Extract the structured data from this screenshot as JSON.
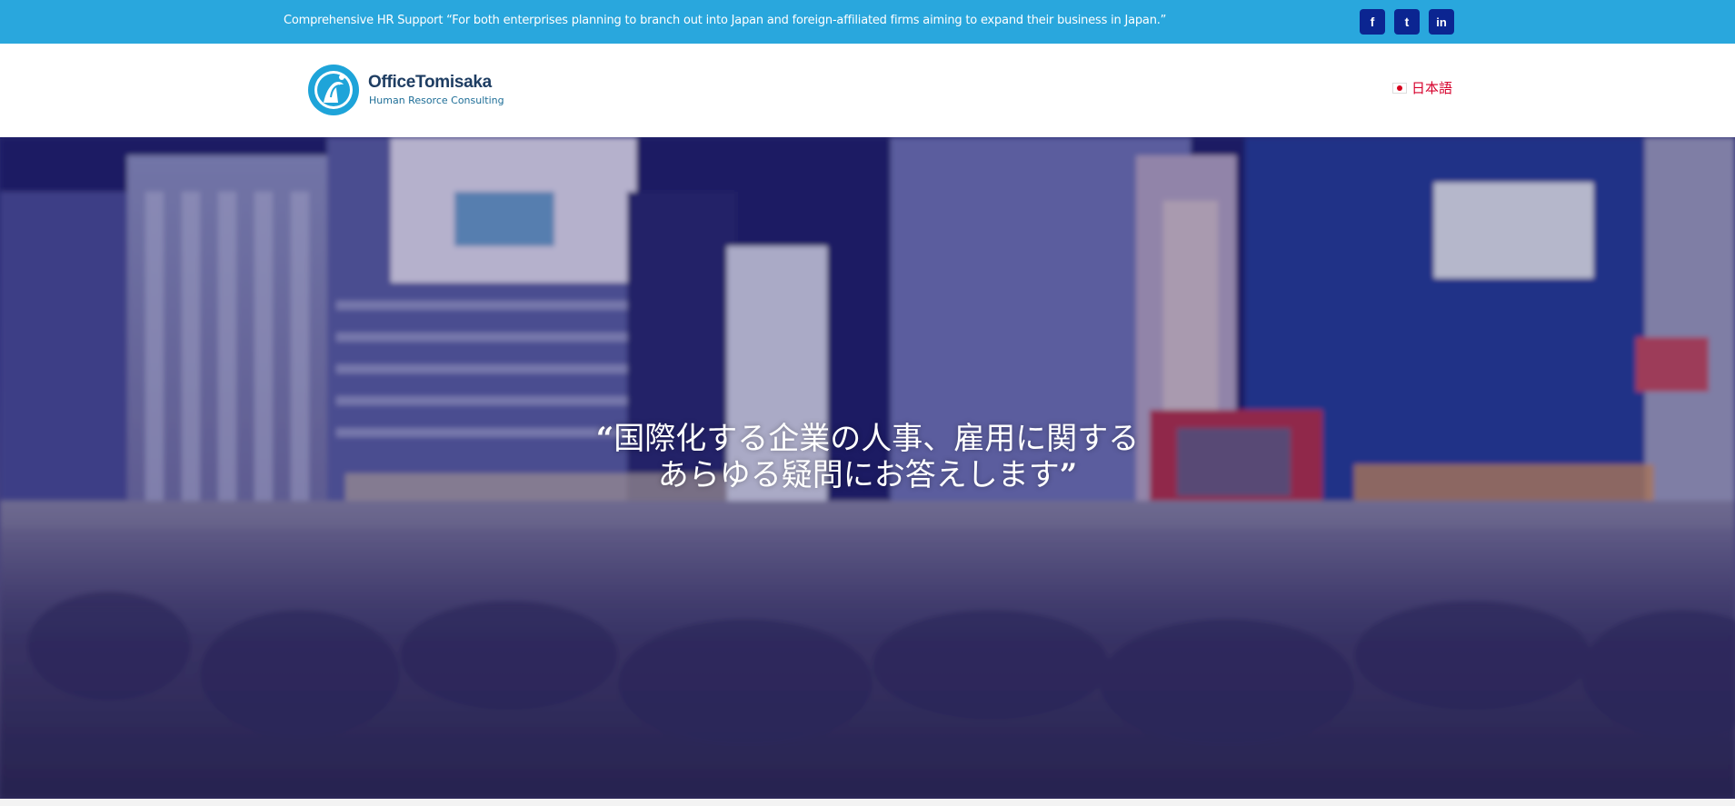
{
  "topbar": {
    "text": "Comprehensive HR Support “For both enterprises planning to branch out into Japan and foreign-affiliated firms aiming to expand their business in Japan.”",
    "background": "#29a7dd",
    "social": [
      {
        "icon": "facebook-icon",
        "glyph": "f"
      },
      {
        "icon": "tumblr-icon",
        "glyph": "t"
      },
      {
        "icon": "linkedin-icon",
        "glyph": "in"
      }
    ]
  },
  "header": {
    "logo": {
      "title": "OfficeTomisaka",
      "subtitle": "Human Resorce Consulting"
    },
    "language": {
      "flag_icon": "japan-flag-icon",
      "label": "日本語",
      "color": "#d6002c"
    }
  },
  "hero": {
    "quote_open": "“",
    "line1": "国際化する企業の人事、雇用に関する",
    "line2": "あらゆる疑問にお答えします",
    "quote_close": "”"
  }
}
